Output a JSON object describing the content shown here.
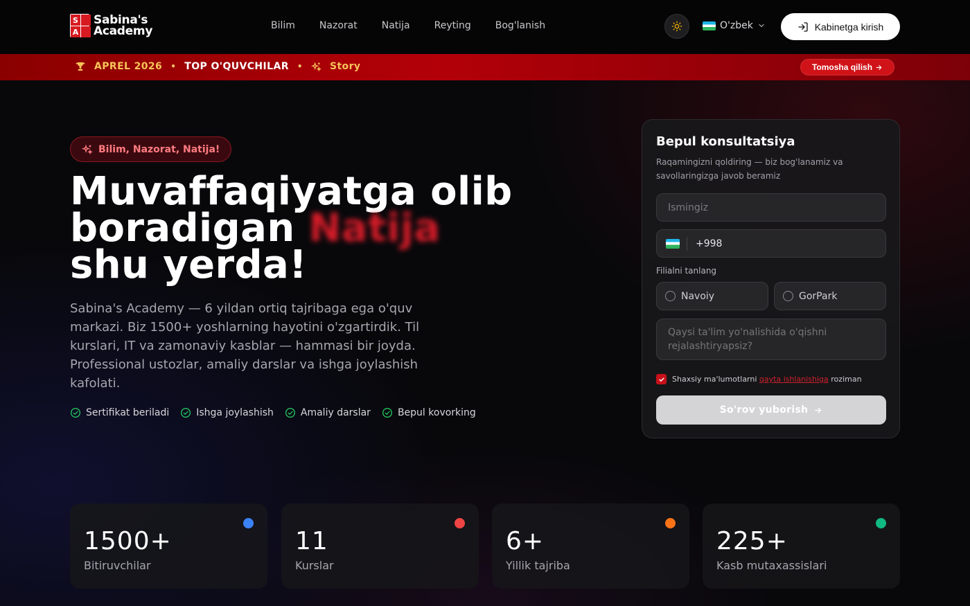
{
  "brand": {
    "logo_letters": [
      "S",
      "A",
      "",
      ""
    ],
    "name_line1": "Sabina's",
    "name_line2": "Academy"
  },
  "nav": [
    "Bilim",
    "Nazorat",
    "Natija",
    "Reyting",
    "Bog'lanish"
  ],
  "header": {
    "language": "O'zbek",
    "login_label": "Kabinetga kirish"
  },
  "banner": {
    "month": "APREL 2026",
    "top": "TOP O'QUVCHILAR",
    "story": "Story",
    "button": "Tomosha qilish"
  },
  "hero": {
    "pill": "Bilim, Nazorat, Natija!",
    "title_line1": "Muvaffaqiyatga olib",
    "title_line2": "boradigan",
    "title_accent": "Natija",
    "title_line3": "shu yerda!",
    "description": "Sabina's Academy — 6 yildan ortiq tajribaga ega o'quv markazi. Biz 1500+ yoshlarning hayotini o'zgartirdik. Til kurslari, IT va zamonaviy kasblar — hammasi bir joyda. Professional ustozlar, amaliy darslar va ishga joylashish kafolati.",
    "features": [
      "Sertifikat beriladi",
      "Ishga joylashish",
      "Amaliy darslar",
      "Bepul kovorking"
    ]
  },
  "form": {
    "title": "Bepul konsultatsiya",
    "subtitle": "Raqamingizni qoldiring — biz bog'lanamiz va savollaringizga javob beramiz",
    "name_placeholder": "Ismingiz",
    "phone_code": "+998",
    "branch_label": "Filialni tanlang",
    "branches": [
      "Navoiy",
      "GorPark"
    ],
    "direction_placeholder": "Qaysi ta'lim yo'nalishida o'qishni rejalashtiryapsiz?",
    "consent_before": "Shaxsiy ma'lumotlarni",
    "consent_link": "qayta ishlanishiga",
    "consent_after": "roziman",
    "submit": "So'rov yuborish"
  },
  "stats": [
    {
      "value": "1500+",
      "label": "Bitiruvchilar",
      "color": "#3b82f6"
    },
    {
      "value": "11",
      "label": "Kurslar",
      "color": "#ef4444"
    },
    {
      "value": "6+",
      "label": "Yillik tajriba",
      "color": "#f97316"
    },
    {
      "value": "225+",
      "label": "Kasb mutaxassislari",
      "color": "#10b981"
    }
  ]
}
